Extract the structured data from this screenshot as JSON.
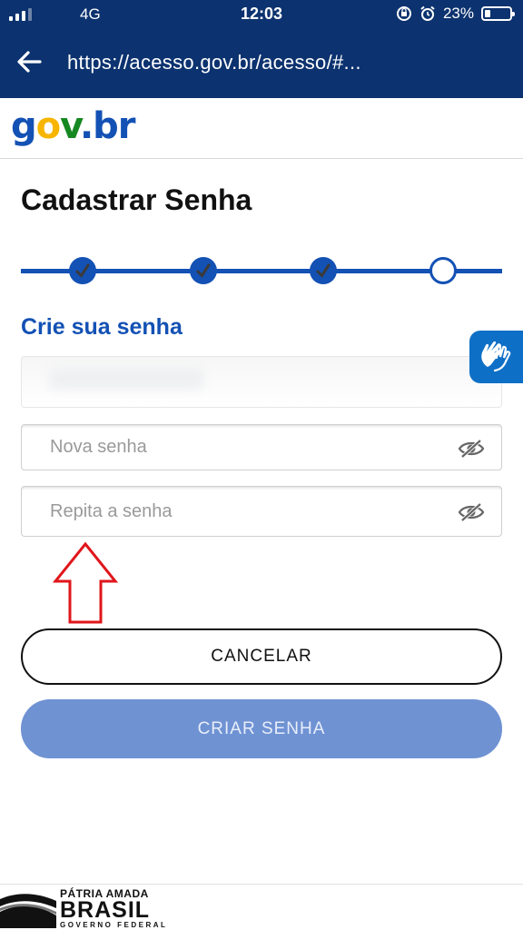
{
  "status_bar": {
    "network": "4G",
    "time": "12:03",
    "battery": "23%",
    "battery_level": 0.23,
    "icons": [
      "signal-icon",
      "rotation-lock-icon",
      "alarm-icon",
      "battery-icon"
    ]
  },
  "browser": {
    "url": "https://acesso.gov.br/acesso/#..."
  },
  "header": {
    "logo_text": "gov.br"
  },
  "page": {
    "title": "Cadastrar Senha",
    "stepper": {
      "total_steps": 4,
      "completed_steps": 3,
      "current_step": 4
    },
    "subtitle": "Crie sua senha",
    "fields": {
      "new_password_placeholder": "Nova senha",
      "repeat_password_placeholder": "Repita a senha"
    },
    "buttons": {
      "cancel": "CANCELAR",
      "create": "CRIAR SENHA"
    }
  },
  "colors": {
    "navy": "#0c326f",
    "primary": "#1351b4",
    "button_disabled": "#6f92d3",
    "annotation_arrow": "#e0161b",
    "vlibras": "#0e6fc6"
  },
  "footer": {
    "line1": "PÁTRIA AMADA",
    "line2": "BRASIL",
    "line3": "GOVERNO FEDERAL"
  }
}
